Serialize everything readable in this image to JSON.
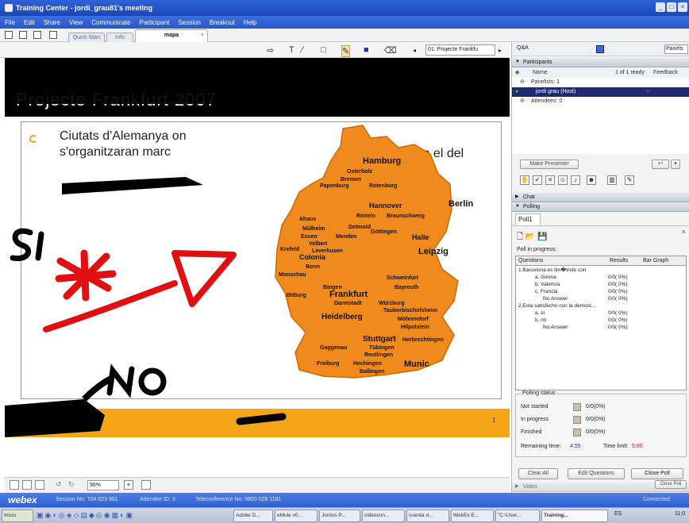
{
  "window": {
    "title": "Training Center - jordi_grau81's meeting"
  },
  "menu": [
    "File",
    "Edit",
    "Share",
    "View",
    "Communicate",
    "Participant",
    "Session",
    "Breakout",
    "Help"
  ],
  "tabs": {
    "quick_start": "Quick Start",
    "info": "Info",
    "active": "mapa",
    "close": "×"
  },
  "annotation": {
    "page_select": "01: Projecte Frankfu"
  },
  "slide": {
    "title": "Projecte Frankfurt 2007",
    "text_left": "Ciutats d'Alemanya on s'organitzaran marc",
    "text_right": "activitats en el del",
    "page_number": "1",
    "handwriting": [
      "SI",
      "NO"
    ],
    "map_cities": [
      "Hamburg",
      "Osterholz",
      "Bremen",
      "Papenburg",
      "Rotenburg",
      "Berlin",
      "Hannover",
      "Rinteln",
      "Braunschweig",
      "Ahaus",
      "Mülheim",
      "Essen",
      "Velbert",
      "Krefeld",
      "Leverkusen",
      "Colonia",
      "Bonn",
      "Monschau",
      "Detmold",
      "Menden",
      "Göttingen",
      "Halle",
      "Leipzig",
      "Schweinfurt",
      "Bayreuth",
      "Bingen",
      "Bitburg",
      "Frankfurt",
      "Darmstadt",
      "Würzburg",
      "Tauberbischofsheim",
      "Heidelberg",
      "Möhrendorf",
      "Hilpolstein",
      "Stuttgart",
      "Herbrechtingen",
      "Gaggenau",
      "Tübingen",
      "Reutlingen",
      "Freiburg",
      "Hechingen",
      "Munic",
      "Ballingen"
    ]
  },
  "zoom": {
    "value": "96%"
  },
  "panel": {
    "qa_label": "Q&A",
    "panels_label": "Panels",
    "participants_header": "Participants",
    "name_col": "Name",
    "ready": "1 of 1 ready",
    "feedback": "Feedback",
    "panelists": "Panelists: 1",
    "host": "jordi grau (Host)",
    "attendees": "Attendees: 0",
    "make_presenter": "Make Presenter",
    "chat_header": "Chat",
    "polling_header": "Polling",
    "poll_tab": "Poll1",
    "poll_in_progress": "Poll in progress:",
    "columns": [
      "Questions",
      "Results",
      "Bar Graph"
    ],
    "rows": [
      {
        "q": "1.Barcelona es lim�trofe con",
        "r": ""
      },
      {
        "q": "a. Girona",
        "r": "0/0( 0%)"
      },
      {
        "q": "b. Valencia",
        "r": "0/0( 0%)"
      },
      {
        "q": "c. Francia",
        "r": "0/0( 0%)"
      },
      {
        "q": "No Answer",
        "r": "0/0( 0%)"
      },
      {
        "q": "2.Esta satisfecho con la demost...",
        "r": ""
      },
      {
        "q": "a. si",
        "r": "0/0( 0%)"
      },
      {
        "q": "b. no",
        "r": "0/0( 0%)"
      },
      {
        "q": "No Answer",
        "r": "0/0( 0%)"
      }
    ],
    "status_title": "Polling status",
    "not_started": "Not started",
    "not_started_val": "0/0(0%)",
    "in_progress": "In progress",
    "in_progress_val": "0/0(0%)",
    "finished": "Finished",
    "finished_val": "0/0(0%)",
    "remaining_label": "Remaining time:",
    "remaining_val": "4:55",
    "limit_label": "Time limit:",
    "limit_val": "5:00",
    "clear_all": "Clear All",
    "edit_questions": "Edit Questions",
    "close_poll": "Close Poll",
    "video_header": "Video",
    "close_poll_btn2": "Close Poll"
  },
  "webex": {
    "brand": "webex",
    "session": "Session No: 704 823 961",
    "attendee": "Attendee ID: 3",
    "teleconf": "Teleconference No: 0800 028 1181",
    "connected": "Connected"
  },
  "taskbar": {
    "start": "Inicio",
    "items": [
      "Adobe D...",
      "eMule v0...",
      "Jordos P...",
      "videocon...",
      "cuenta d...",
      "WebEx E...",
      "\"C:\\User...",
      "Training..."
    ],
    "lang": "ES",
    "clock": "11:0"
  }
}
